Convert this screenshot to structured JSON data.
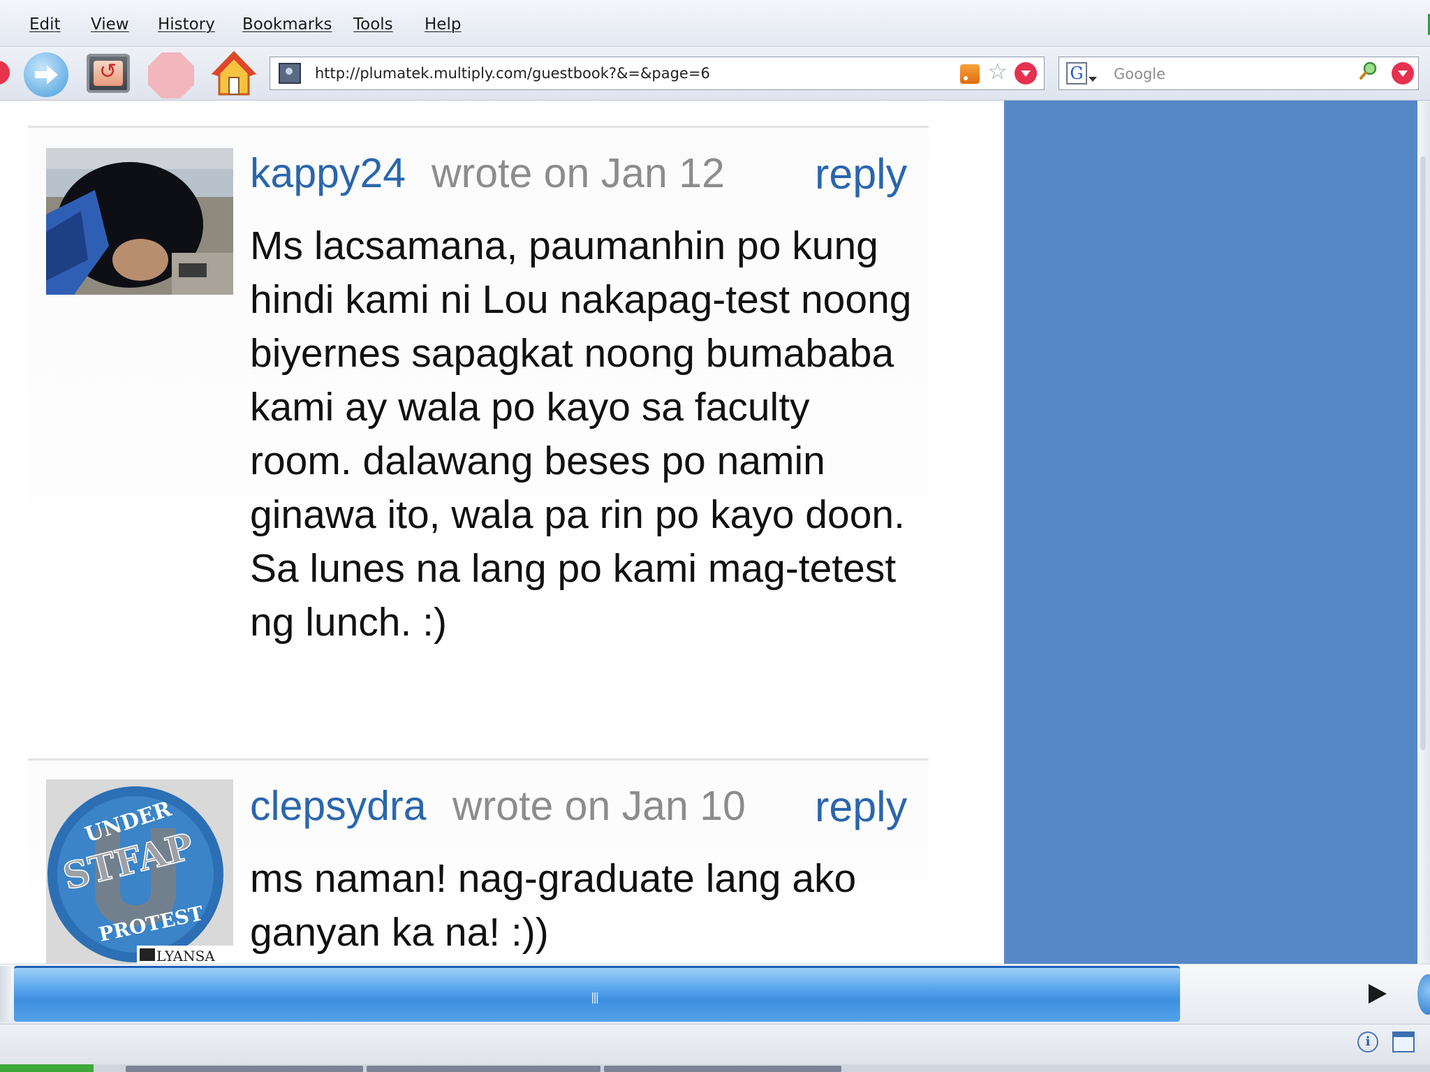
{
  "menu": {
    "items": [
      "Edit",
      "View",
      "History",
      "Bookmarks",
      "Tools",
      "Help"
    ]
  },
  "toolbar": {
    "icons": {
      "forward": "forward-icon",
      "reload": "reload-icon",
      "stop": "stop-icon",
      "home": "home-icon"
    }
  },
  "address_bar": {
    "url": "http://plumatek.multiply.com/guestbook?&=&page=6",
    "icons": [
      "site-icon",
      "rss-icon",
      "star-icon",
      "dropdown-icon"
    ]
  },
  "search_bar": {
    "engine_letter": "G",
    "placeholder": "Google"
  },
  "guestbook": {
    "entries": [
      {
        "author": "kappy24",
        "meta": "wrote on Jan 12",
        "reply_label": "reply",
        "body": "Ms lacsamana, paumanhin po kung hindi kami ni Lou nakapag-test noong biyernes sapagkat noong bumababa kami ay wala po kayo sa faculty room. dalawang beses po namin ginawa ito, wala pa rin po kayo doon. Sa lunes na lang po kami mag-tetest ng lunch. :)"
      },
      {
        "author": "clepsydra",
        "meta": "wrote on Jan 10",
        "reply_label": "reply",
        "body": "ms naman! nag-graduate lang ako ganyan ka na! :))",
        "avatar_text": {
          "top": "UNDER",
          "middle": "STFAP",
          "bottom": "PROTEST",
          "badge": "LYANSA"
        }
      }
    ]
  },
  "colors": {
    "link": "#2a66ad",
    "meta": "#8c8c8c",
    "sidebar": "#5687c7",
    "scroll_thumb": "#3d8fe0"
  }
}
